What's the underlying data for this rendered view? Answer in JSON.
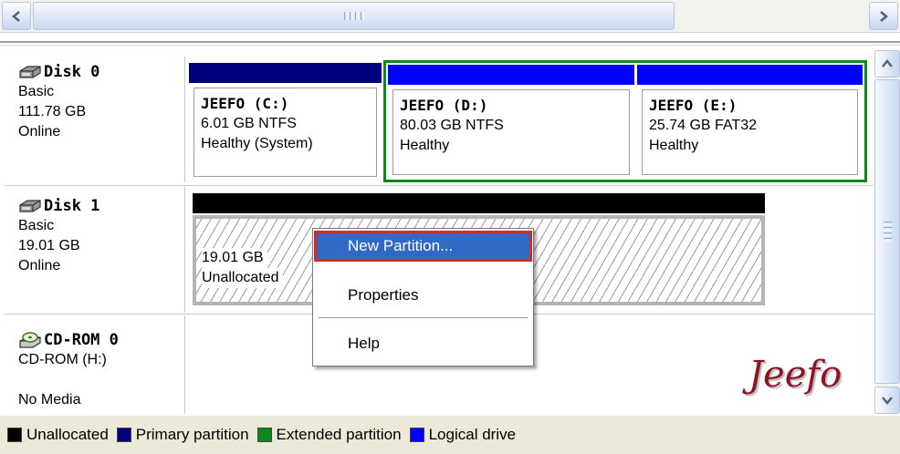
{
  "disks": [
    {
      "title": "Disk 0",
      "type": "Basic",
      "size": "111.78 GB",
      "status": "Online",
      "icon": "hard-disk-icon"
    },
    {
      "title": "Disk 1",
      "type": "Basic",
      "size": "19.01 GB",
      "status": "Online",
      "icon": "hard-disk-icon"
    },
    {
      "title": "CD-ROM 0",
      "type": "CD-ROM (H:)",
      "status": "No Media",
      "icon": "cd-rom-icon"
    }
  ],
  "partitions": [
    {
      "name": "JEEFO  (C:)",
      "size_fs": "6.01 GB NTFS",
      "status": "Healthy (System)",
      "kind": "primary"
    },
    {
      "name": "JEEFO  (D:)",
      "size_fs": "80.03 GB NTFS",
      "status": "Healthy",
      "kind": "logical"
    },
    {
      "name": "JEEFO  (E:)",
      "size_fs": "25.74 GB FAT32",
      "status": "Healthy",
      "kind": "logical"
    }
  ],
  "unallocated": {
    "size": "19.01 GB",
    "label": "Unallocated"
  },
  "context_menu": {
    "items": [
      "New Partition...",
      "Properties",
      "Help"
    ],
    "selected": "New Partition..."
  },
  "legend": [
    {
      "label": "Unallocated",
      "color": "#000000"
    },
    {
      "label": "Primary partition",
      "color": "#00007f"
    },
    {
      "label": "Extended partition",
      "color": "#0b8a1c"
    },
    {
      "label": "Logical drive",
      "color": "#0000ff"
    }
  ],
  "colors": {
    "primary_bar": "#00007f",
    "logical_bar": "#0000ff",
    "extended_border": "#0b8a1c",
    "unallocated_bar": "#000000"
  },
  "watermark": "Jeefo"
}
